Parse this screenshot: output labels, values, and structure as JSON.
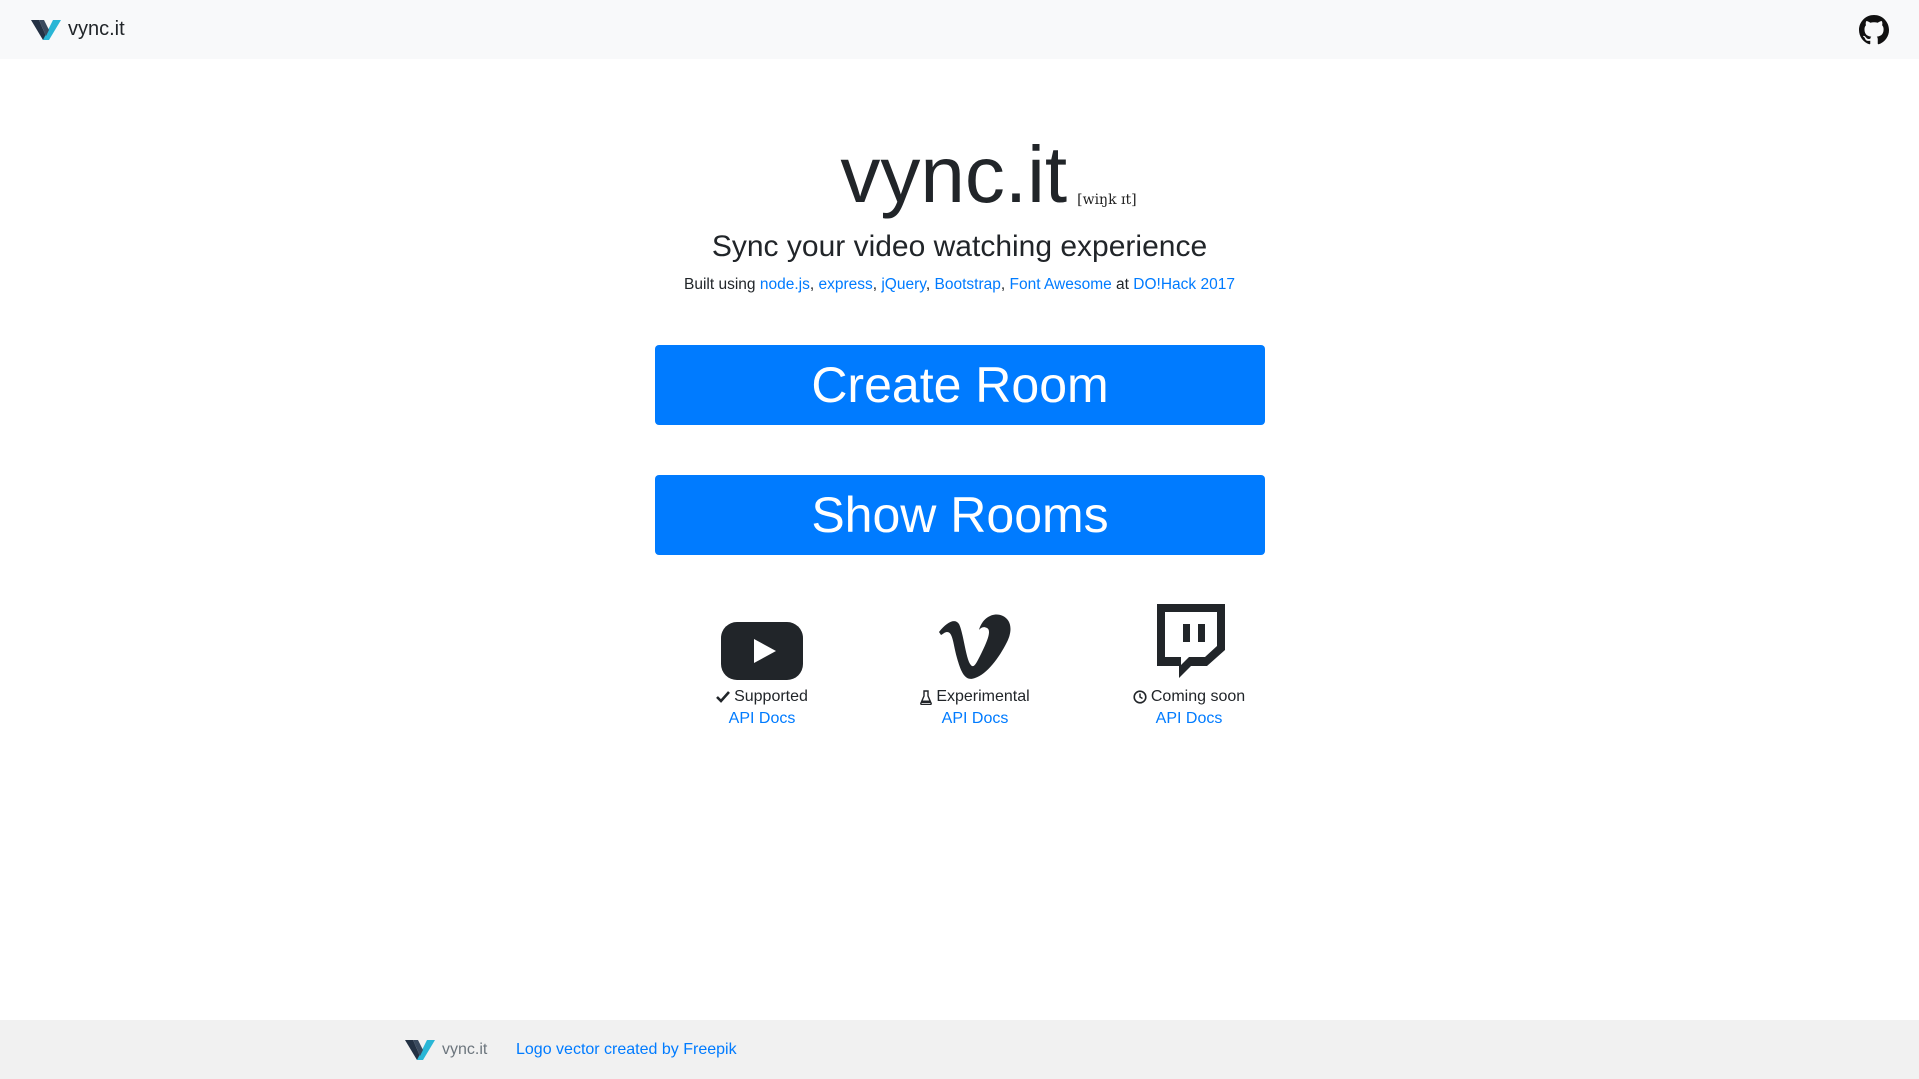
{
  "navbar": {
    "brand": "vync.it",
    "github_icon": "github-icon"
  },
  "hero": {
    "title": "vync.it",
    "pronunciation": "[wiŋk ɪt]",
    "subtitle": "Sync your video watching experience",
    "built_prefix": "Built using",
    "tech": [
      "node.js",
      "express",
      "jQuery",
      "Bootstrap",
      "Font Awesome"
    ],
    "built_at": "at",
    "event": "DO!Hack 2017"
  },
  "buttons": {
    "create": "Create Room",
    "show": "Show Rooms"
  },
  "providers": [
    {
      "icon": "youtube-icon",
      "status_icon": "check-icon",
      "status": "Supported",
      "link": "API Docs"
    },
    {
      "icon": "vimeo-icon",
      "status_icon": "flask-icon",
      "status": "Experimental",
      "link": "API Docs"
    },
    {
      "icon": "twitch-icon",
      "status_icon": "clock-icon",
      "status": "Coming soon",
      "link": "API Docs"
    }
  ],
  "footer": {
    "brand": "vync.it",
    "credit": "Logo vector created by Freepik"
  },
  "colors": {
    "primary": "#007bff",
    "navbar_bg": "#f8f9fa",
    "footer_bg": "#f1f1f1",
    "logo_dark": "#233143",
    "logo_teal": "#29b6d6"
  }
}
